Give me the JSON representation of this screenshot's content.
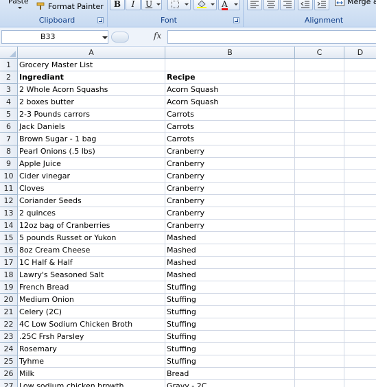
{
  "ribbon": {
    "paste_label": "Paste",
    "format_painter_label": "Format Painter",
    "merge_label": "Merge &",
    "groups": {
      "clipboard": "Clipboard",
      "font": "Font",
      "alignment": "Alignment"
    },
    "font_buttons": {
      "bold": "B",
      "italic": "I",
      "underline": "U",
      "font_color": "A"
    }
  },
  "formula_bar": {
    "name_box": "B33",
    "fx": "fx",
    "formula": ""
  },
  "columns": [
    "A",
    "B",
    "C",
    "D"
  ],
  "rows": [
    {
      "n": "1",
      "a": "Grocery Master List",
      "b": ""
    },
    {
      "n": "2",
      "a": "Ingrediant",
      "b": "Recipe",
      "bold": true
    },
    {
      "n": "3",
      "a": "2 Whole Acorn Squashs",
      "b": "Acorn Squash"
    },
    {
      "n": "4",
      "a": "2 boxes butter",
      "b": "Acorn Squash"
    },
    {
      "n": "5",
      "a": "2-3 Pounds carrors",
      "b": "Carrots"
    },
    {
      "n": "6",
      "a": "Jack Daniels",
      "b": "Carrots"
    },
    {
      "n": "7",
      "a": "Brown Sugar - 1 bag",
      "b": "Carrots"
    },
    {
      "n": "8",
      "a": "Pearl Onions (.5 lbs)",
      "b": "Cranberry"
    },
    {
      "n": "9",
      "a": "Apple Juice",
      "b": "Cranberry"
    },
    {
      "n": "10",
      "a": "Cider vinegar",
      "b": "Cranberry"
    },
    {
      "n": "11",
      "a": "Cloves",
      "b": "Cranberry"
    },
    {
      "n": "12",
      "a": "Coriander Seeds",
      "b": "Cranberry"
    },
    {
      "n": "13",
      "a": "2 quinces",
      "b": "Cranberry"
    },
    {
      "n": "14",
      "a": "12oz bag of Cranberries",
      "b": "Cranberry"
    },
    {
      "n": "15",
      "a": "5 pounds Russet or Yukon",
      "b": "Mashed"
    },
    {
      "n": "16",
      "a": "8oz Cream Cheese",
      "b": "Mashed"
    },
    {
      "n": "17",
      "a": "1C Half & Half",
      "b": "Mashed"
    },
    {
      "n": "18",
      "a": "Lawry's Seasoned Salt",
      "b": "Mashed"
    },
    {
      "n": "19",
      "a": "French Bread",
      "b": "Stuffing"
    },
    {
      "n": "20",
      "a": "Medium Onion",
      "b": "Stuffing"
    },
    {
      "n": "21",
      "a": "Celery (2C)",
      "b": "Stuffing"
    },
    {
      "n": "22",
      "a": "4C Low Sodium Chicken Broth",
      "b": "Stuffing"
    },
    {
      "n": "23",
      "a": ".25C Frsh Parsley",
      "b": "Stuffing"
    },
    {
      "n": "24",
      "a": "Rosemary",
      "b": "Stuffing"
    },
    {
      "n": "25",
      "a": "Tyhme",
      "b": "Stuffing"
    },
    {
      "n": "26",
      "a": "Milk",
      "b": "Bread"
    },
    {
      "n": "27",
      "a": "Low sodium chicken browth",
      "b": "Gravy - 2C"
    }
  ]
}
